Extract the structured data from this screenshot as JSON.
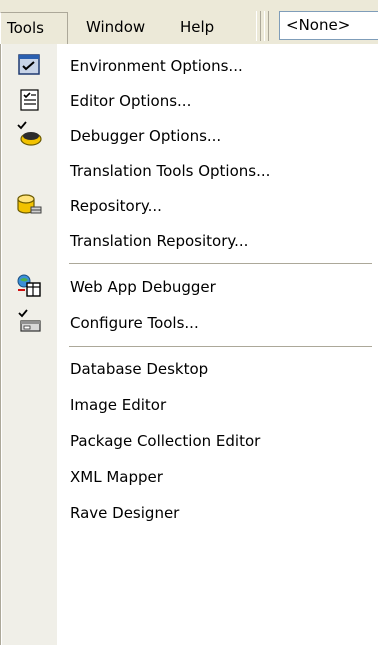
{
  "menubar": {
    "tools": "Tools",
    "window": "Window",
    "help": "Help",
    "combo_value": "<None>"
  },
  "menu": {
    "items": [
      {
        "label": "Environment Options...",
        "icon": "environment-options-icon"
      },
      {
        "label": "Editor Options...",
        "icon": "editor-options-icon"
      },
      {
        "label": "Debugger Options...",
        "icon": "debugger-options-icon"
      },
      {
        "label": "Translation Tools Options...",
        "icon": ""
      },
      {
        "label": "Repository...",
        "icon": "repository-icon"
      },
      {
        "label": "Translation Repository...",
        "icon": ""
      },
      {
        "label": "Web App Debugger",
        "icon": "web-app-debugger-icon"
      },
      {
        "label": "Configure Tools...",
        "icon": "configure-tools-icon"
      },
      {
        "label": "Database Desktop",
        "icon": ""
      },
      {
        "label": "Image Editor",
        "icon": ""
      },
      {
        "label": "Package Collection Editor",
        "icon": ""
      },
      {
        "label": "XML Mapper",
        "icon": ""
      },
      {
        "label": "Rave Designer",
        "icon": ""
      }
    ]
  }
}
